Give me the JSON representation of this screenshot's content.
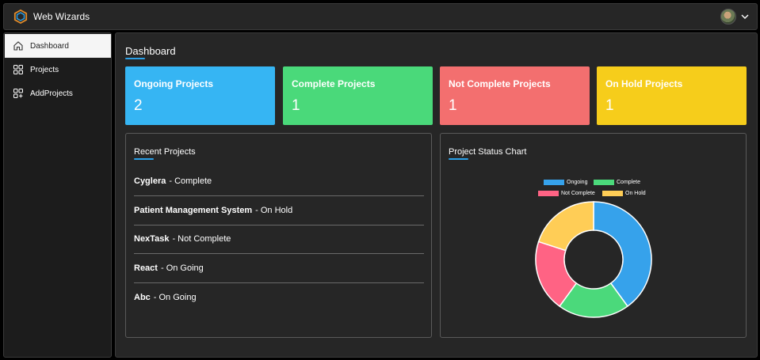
{
  "header": {
    "app_title": "Web Wizards"
  },
  "sidebar": {
    "items": [
      {
        "label": "Dashboard",
        "icon": "home-icon"
      },
      {
        "label": "Projects",
        "icon": "grid-icon"
      },
      {
        "label": "AddProjects",
        "icon": "grid-add-icon"
      }
    ]
  },
  "main": {
    "title": "Dashboard"
  },
  "cards": [
    {
      "label": "Ongoing Projects",
      "value": "2",
      "color": "#36b5f3"
    },
    {
      "label": "Complete Projects",
      "value": "1",
      "color": "#4ad97a"
    },
    {
      "label": "Not Complete Projects",
      "value": "1",
      "color": "#f36f6f"
    },
    {
      "label": "On Hold Projects",
      "value": "1",
      "color": "#f6cd1b"
    }
  ],
  "recent": {
    "title": "Recent Projects",
    "items": [
      {
        "name": "Cyglera",
        "status": "- Complete"
      },
      {
        "name": "Patient Management System",
        "status": "- On Hold"
      },
      {
        "name": "NexTask",
        "status": "- Not Complete"
      },
      {
        "name": "React",
        "status": "- On Going"
      },
      {
        "name": "Abc",
        "status": "- On Going"
      }
    ]
  },
  "status_chart": {
    "title": "Project Status Chart"
  },
  "chart_data": {
    "type": "pie",
    "variant": "doughnut",
    "categories": [
      "Ongoing",
      "Complete",
      "Not Complete",
      "On Hold"
    ],
    "values": [
      2,
      1,
      1,
      1
    ],
    "colors": [
      "#36a2eb",
      "#4bd97b",
      "#ff6384",
      "#ffcd56"
    ],
    "legend": "top"
  }
}
